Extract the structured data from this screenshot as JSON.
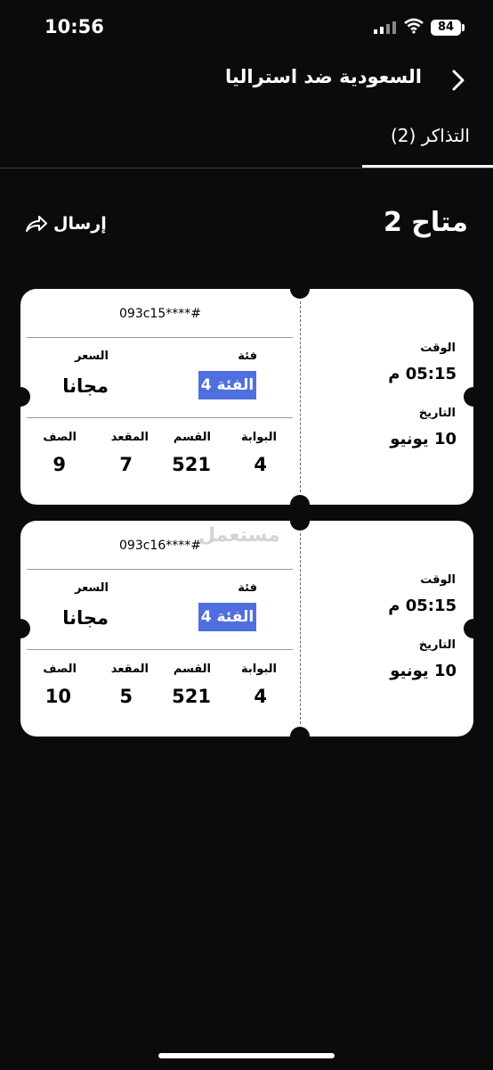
{
  "status_bar": {
    "time": "10:56",
    "battery": "84"
  },
  "header": {
    "title": "السعودية ضد استراليا"
  },
  "tabs": [
    {
      "label": "التذاكر (2)"
    }
  ],
  "section": {
    "available": "متاح 2",
    "send_label": "إرسال"
  },
  "labels": {
    "time": "الوقت",
    "date": "التاريخ",
    "category": "فئة",
    "price": "السعر",
    "gate": "البوابة",
    "section": "القسم",
    "seat": "المقعد",
    "row": "الصف"
  },
  "tickets": [
    {
      "code": "093c15****#",
      "time": "05:15 م",
      "date": "10 يونيو",
      "category": "الفئة 4",
      "price": "مجانا",
      "gate": "4",
      "section": "521",
      "seat": "7",
      "row": "9"
    },
    {
      "code": "093c16****#",
      "time": "05:15 م",
      "date": "10 يونيو",
      "category": "الفئة 4",
      "price": "مجانا",
      "gate": "4",
      "section": "521",
      "seat": "5",
      "row": "10"
    }
  ],
  "watermark": "مستعمل",
  "colors": {
    "background": "#0b0b0b",
    "category_highlight": "#4f6fe0"
  }
}
